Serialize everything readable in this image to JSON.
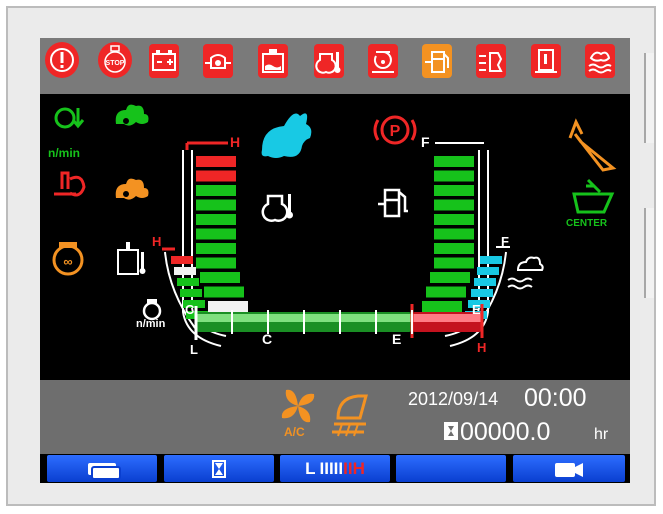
{
  "icons": {
    "warnings": [
      "warning-circle-icon",
      "stop-engine-icon",
      "battery-charge-icon",
      "engine-oil-pressure-icon",
      "radiator-water-level-icon",
      "engine-oil-level-icon",
      "hydraulic-oil-icon",
      "fuel-filter-water-icon",
      "injector-icon",
      "coolant-level-icon",
      "water-separator-icon"
    ]
  },
  "pilots": {
    "rpm_unit": "n/min",
    "center_label": "CENTER"
  },
  "gauges": {
    "coolant": {
      "high": "H",
      "low": "C"
    },
    "fuel": {
      "full": "F",
      "empty": "E"
    },
    "hydraulic": {
      "high": "H",
      "low": "C"
    },
    "def": {
      "full": "F",
      "empty": "E"
    },
    "rpm_bar": {
      "unit": "n/min",
      "low": "L",
      "high": "H"
    }
  },
  "status": {
    "ac_label": "A/C",
    "date": "2012/09/14",
    "time": "00:00",
    "hours": "00000.0",
    "hours_unit": "hr"
  },
  "nav": {
    "f3_label_white": "L",
    "f3_label_bars": "IIIII",
    "f3_label_red": "IIH"
  },
  "colors": {
    "warning": "#ef2626",
    "caution": "#f39222",
    "ok": "#16c21b",
    "cyan": "#18c9e4",
    "nav_blue": "#1652ea"
  }
}
